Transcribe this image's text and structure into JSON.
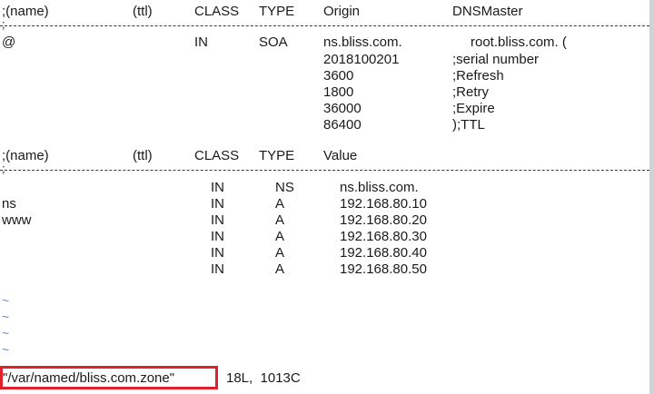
{
  "soa_header": {
    "name": ";(name)",
    "ttl": "(ttl)",
    "class": "CLASS",
    "type": "TYPE",
    "origin": "Origin",
    "master": "DNSMaster"
  },
  "separator_char": ";",
  "soa": {
    "name": "@",
    "class": "IN",
    "type": "SOA",
    "origin": "ns.bliss.com.",
    "master": "root.bliss.com. (",
    "values": [
      "2018100201",
      "3600",
      "1800",
      "36000",
      "86400"
    ],
    "comments": [
      ";serial number",
      ";Refresh",
      ";Retry",
      ";Expire",
      ");TTL"
    ]
  },
  "rr_header": {
    "name": ";(name)",
    "ttl": "(ttl)",
    "class": "CLASS",
    "type": "TYPE",
    "value": "Value"
  },
  "records": [
    {
      "name": "",
      "class": "IN",
      "type": "NS",
      "value": "ns.bliss.com."
    },
    {
      "name": "ns",
      "class": "IN",
      "type": "A",
      "value": "192.168.80.10"
    },
    {
      "name": "www",
      "class": "IN",
      "type": "A",
      "value": "192.168.80.20"
    },
    {
      "name": "",
      "class": "IN",
      "type": "A",
      "value": "192.168.80.30"
    },
    {
      "name": "",
      "class": "IN",
      "type": "A",
      "value": "192.168.80.40"
    },
    {
      "name": "",
      "class": "IN",
      "type": "A",
      "value": "192.168.80.50"
    }
  ],
  "empty_line_marker": "~",
  "status": {
    "filename": "\"/var/named/bliss.com.zone\"",
    "info": "18L,  1013C"
  },
  "colors": {
    "highlight_box": "#e0202a",
    "tilde": "#6a8cc8"
  }
}
